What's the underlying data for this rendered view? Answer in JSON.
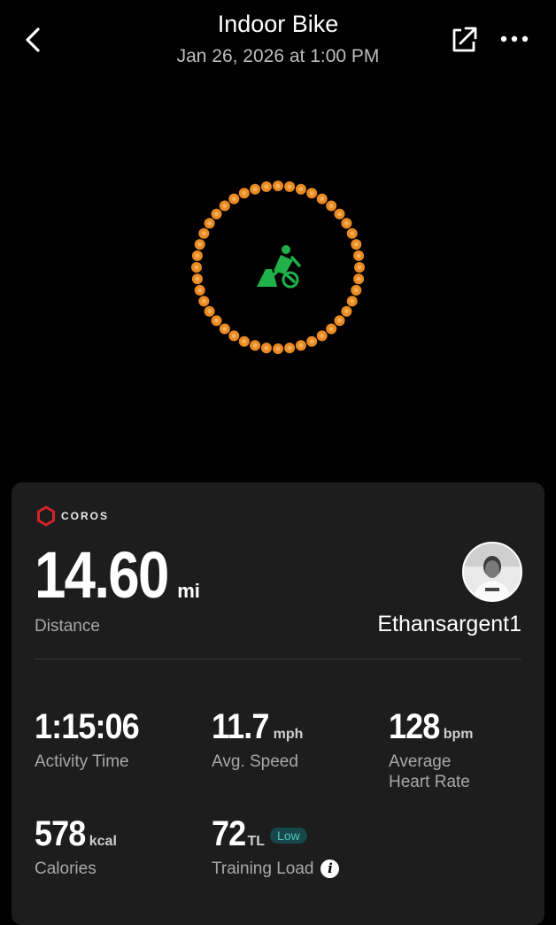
{
  "header": {
    "title": "Indoor Bike",
    "subtitle": "Jan 26, 2026 at 1:00 PM",
    "icons": {
      "back": "chevron-left-icon",
      "share": "share-icon",
      "more": "more-icon"
    }
  },
  "activity_icon": "stationary-bike-icon",
  "colors": {
    "ring": "#e98a22",
    "ring_center": "#f4b05a",
    "activity_icon": "#21b14a",
    "badge_bg": "#17474a",
    "badge_text": "#4fc6c0"
  },
  "card": {
    "brand": "COROS",
    "distance": {
      "value": "14.60",
      "unit": "mi",
      "label": "Distance"
    },
    "username": "Ethansargent1",
    "stats": {
      "activity_time": {
        "value": "1:15:06",
        "label": "Activity Time"
      },
      "avg_speed": {
        "value": "11.7",
        "unit": "mph",
        "label": "Avg. Speed"
      },
      "avg_hr": {
        "value": "128",
        "unit": "bpm",
        "label_line1": "Average",
        "label_line2": "Heart Rate"
      },
      "calories": {
        "value": "578",
        "unit": "kcal",
        "label": "Calories"
      },
      "training_load": {
        "value": "72",
        "unit": "TL",
        "badge": "Low",
        "label": "Training Load"
      }
    }
  }
}
